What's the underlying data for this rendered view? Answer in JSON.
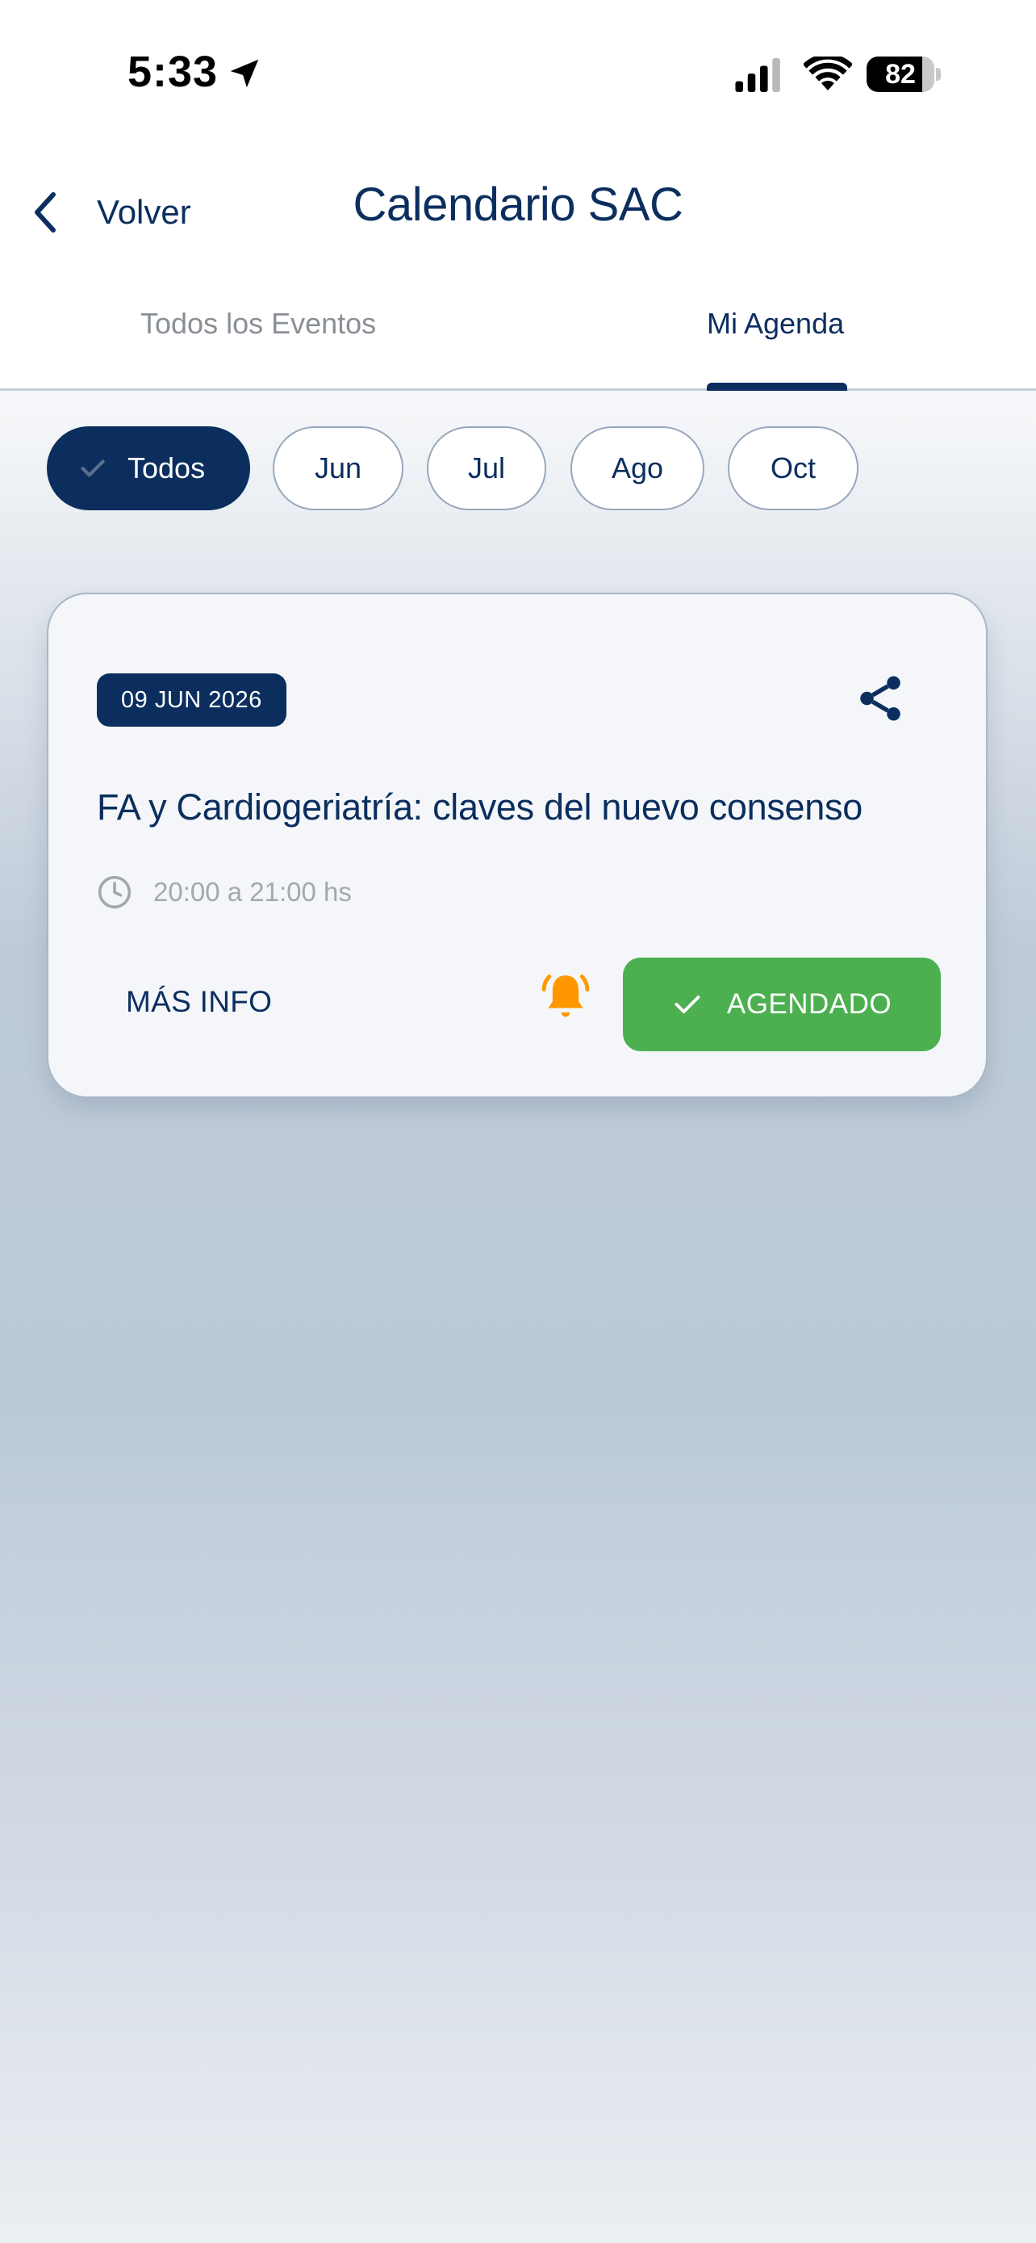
{
  "status_bar": {
    "time": "5:33",
    "battery_level": "82",
    "battery_fraction": 0.82,
    "icons": [
      "location-arrow-icon",
      "cellular-signal-icon",
      "wifi-icon",
      "battery-icon"
    ]
  },
  "nav": {
    "back_label": "Volver",
    "title": "Calendario SAC",
    "back_icon": "chevron-left-icon"
  },
  "tabs": {
    "items": [
      {
        "label": "Todos los Eventos",
        "active": false
      },
      {
        "label": "Mi Agenda",
        "active": true
      }
    ]
  },
  "filters": {
    "items": [
      {
        "label": "Todos",
        "selected": true
      },
      {
        "label": "Jun",
        "selected": false
      },
      {
        "label": "Jul",
        "selected": false
      },
      {
        "label": "Ago",
        "selected": false
      },
      {
        "label": "Oct",
        "selected": false
      }
    ]
  },
  "event": {
    "date": "09 JUN 2026",
    "title": "FA y Cardiogeriatría: claves del nuevo consenso",
    "time": "20:00 a 21:00 hs",
    "more_info_label": "MÁS INFO",
    "scheduled_label": "AGENDADO",
    "icons": [
      "share-icon",
      "clock-icon",
      "bell-icon",
      "check-icon"
    ]
  },
  "colors": {
    "primary_navy": "#0b2e5e",
    "success_green": "#4caf50",
    "bell_orange": "#ff9800",
    "muted_gray": "#a4a8ae"
  }
}
